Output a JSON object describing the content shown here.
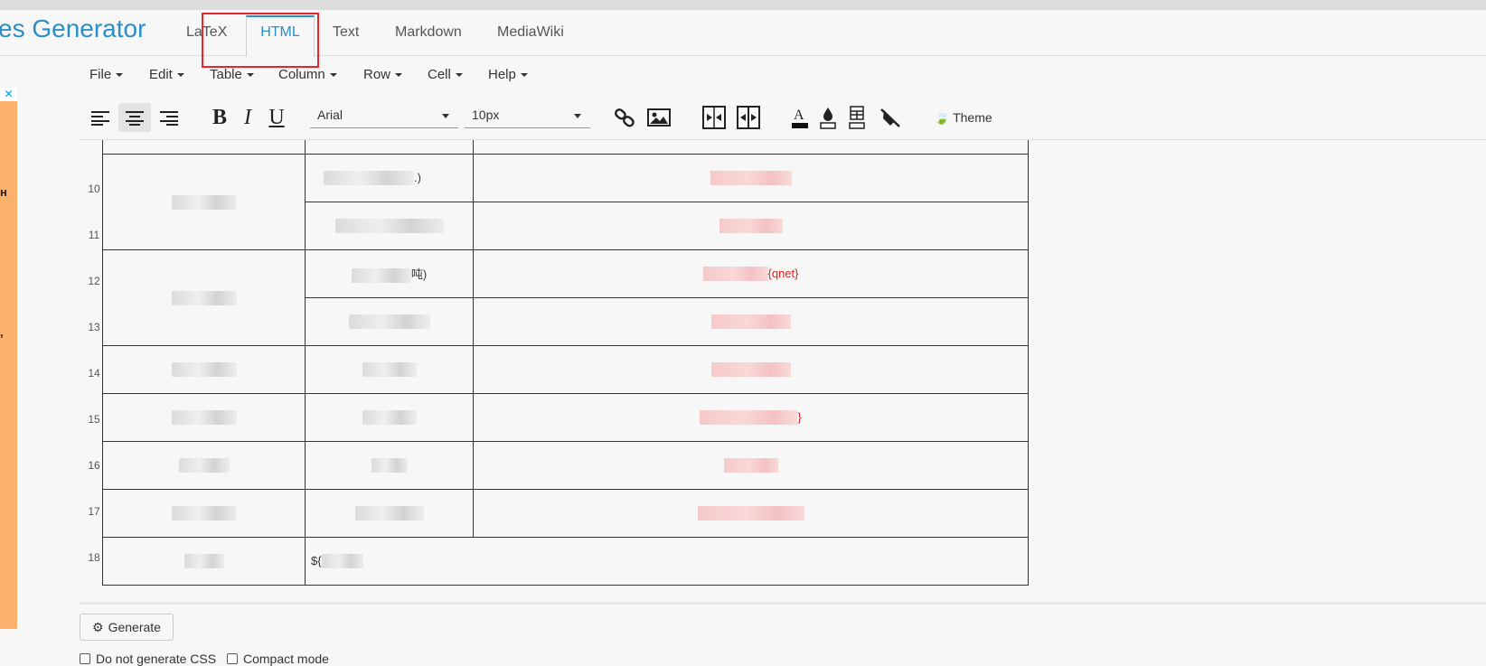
{
  "brand": {
    "title": "es Generator"
  },
  "tabs": [
    {
      "label": "LaTeX"
    },
    {
      "label": "HTML"
    },
    {
      "label": "Text"
    },
    {
      "label": "Markdown"
    },
    {
      "label": "MediaWiki"
    }
  ],
  "ad": {
    "close": "✕",
    "marks": [
      "н",
      ","
    ]
  },
  "menu": [
    "File",
    "Edit",
    "Table",
    "Column",
    "Row",
    "Cell",
    "Help"
  ],
  "toolbar": {
    "font": "Arial",
    "size": "10px",
    "theme": "Theme",
    "bold": "B",
    "italic": "I",
    "underline": "U",
    "text_color": "A"
  },
  "rows": {
    "numbers": [
      "10",
      "11",
      "12",
      "13",
      "14",
      "15",
      "16",
      "17",
      "18"
    ],
    "r10_c2_suffix": ".)",
    "r12_c2_suffix": "吨)",
    "r12_c3_suffix": "{qnet}",
    "r15_c3_suffix": "}",
    "r18_c2_prefix": "${"
  },
  "footer": {
    "generate": "Generate",
    "no_css": "Do not generate CSS",
    "compact": "Compact mode"
  }
}
